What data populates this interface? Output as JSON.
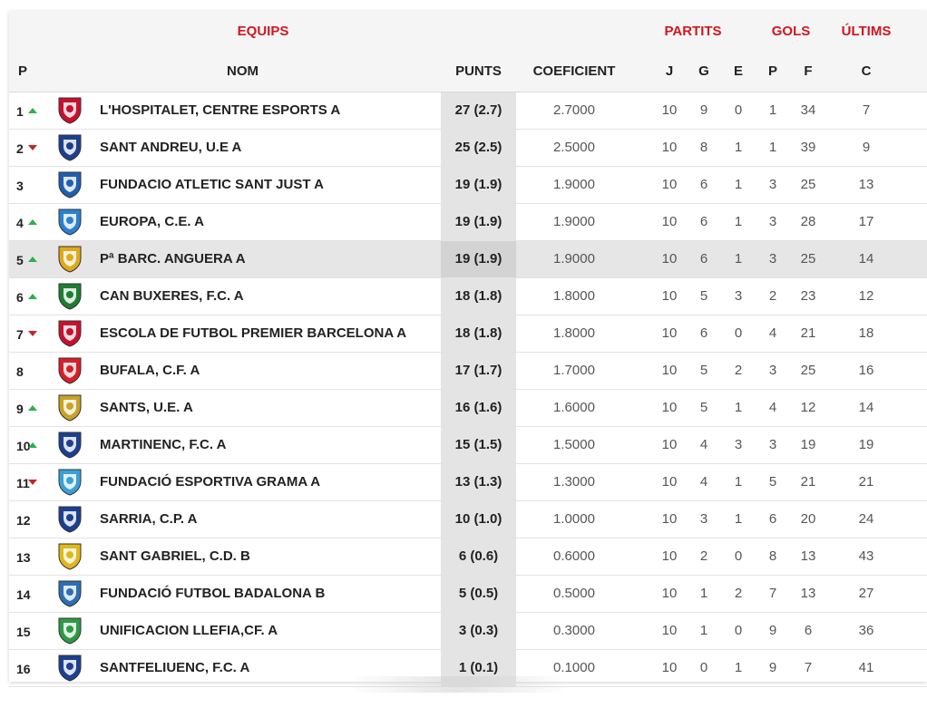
{
  "header": {
    "group_equips": "EQUIPS",
    "group_partits": "PARTITS",
    "group_gols": "GOLS",
    "group_ultims": "ÚLTIMS",
    "col_p": "P",
    "col_nom": "NOM",
    "col_punts": "PUNTS",
    "col_coef": "COEFICIENT",
    "col_j": "J",
    "col_g": "G",
    "col_e": "E",
    "col_pp": "P",
    "col_f": "F",
    "col_c": "C"
  },
  "colors": {
    "accent": "#d0161f",
    "up": "#2eb04b",
    "down": "#c0272d",
    "highlight_row": "#e6e6e6"
  },
  "rows": [
    {
      "pos": "1",
      "trend": "up",
      "crest": "hospitalet-crest-icon",
      "crest_color": "#c8102e",
      "name": "L'HOSPITALET, CENTRE ESPORTS A",
      "punts": "27 (2.7)",
      "coef": "2.7000",
      "j": "10",
      "g": "9",
      "e": "0",
      "p": "1",
      "f": "34",
      "c": "7"
    },
    {
      "pos": "2",
      "trend": "down",
      "crest": "sant-andreu-crest-icon",
      "crest_color": "#1d3f8f",
      "name": "SANT ANDREU, U.E A",
      "punts": "25 (2.5)",
      "coef": "2.5000",
      "j": "10",
      "g": "8",
      "e": "1",
      "p": "1",
      "f": "39",
      "c": "9"
    },
    {
      "pos": "3",
      "trend": "none",
      "crest": "fundacio-atletic-crest-icon",
      "crest_color": "#1f5fb0",
      "name": "FUNDACIO ATLETIC SANT JUST A",
      "punts": "19 (1.9)",
      "coef": "1.9000",
      "j": "10",
      "g": "6",
      "e": "1",
      "p": "3",
      "f": "25",
      "c": "13"
    },
    {
      "pos": "4",
      "trend": "up",
      "crest": "europa-crest-icon",
      "crest_color": "#2c7fd1",
      "name": "EUROPA, C.E. A",
      "punts": "19 (1.9)",
      "coef": "1.9000",
      "j": "10",
      "g": "6",
      "e": "1",
      "p": "3",
      "f": "28",
      "c": "17"
    },
    {
      "pos": "5",
      "trend": "up",
      "crest": "anguera-crest-icon",
      "crest_color": "#e0a81c",
      "name": "Pª BARC. ANGUERA A",
      "punts": "19 (1.9)",
      "coef": "1.9000",
      "j": "10",
      "g": "6",
      "e": "1",
      "p": "3",
      "f": "25",
      "c": "14"
    },
    {
      "pos": "6",
      "trend": "up",
      "crest": "can-buxeres-crest-icon",
      "crest_color": "#1e7d32",
      "name": "CAN BUXERES, F.C. A",
      "punts": "18 (1.8)",
      "coef": "1.8000",
      "j": "10",
      "g": "5",
      "e": "3",
      "p": "2",
      "f": "23",
      "c": "12"
    },
    {
      "pos": "7",
      "trend": "down",
      "crest": "premier-barcelona-crest-icon",
      "crest_color": "#c8102e",
      "name": "ESCOLA DE FUTBOL PREMIER BARCELONA A",
      "punts": "18 (1.8)",
      "coef": "1.8000",
      "j": "10",
      "g": "6",
      "e": "0",
      "p": "4",
      "f": "21",
      "c": "18"
    },
    {
      "pos": "8",
      "trend": "none",
      "crest": "bufala-crest-icon",
      "crest_color": "#d81f26",
      "name": "BUFALA, C.F. A",
      "punts": "17 (1.7)",
      "coef": "1.7000",
      "j": "10",
      "g": "5",
      "e": "2",
      "p": "3",
      "f": "25",
      "c": "16"
    },
    {
      "pos": "9",
      "trend": "up",
      "crest": "sants-crest-icon",
      "crest_color": "#c9a227",
      "name": "SANTS, U.E. A",
      "punts": "16 (1.6)",
      "coef": "1.6000",
      "j": "10",
      "g": "5",
      "e": "1",
      "p": "4",
      "f": "12",
      "c": "14"
    },
    {
      "pos": "10",
      "trend": "up",
      "crest": "martinenc-crest-icon",
      "crest_color": "#1d3f8f",
      "name": "MARTINENC, F.C. A",
      "punts": "15 (1.5)",
      "coef": "1.5000",
      "j": "10",
      "g": "4",
      "e": "3",
      "p": "3",
      "f": "19",
      "c": "19"
    },
    {
      "pos": "11",
      "trend": "down",
      "crest": "grama-crest-icon",
      "crest_color": "#3aa0d8",
      "name": "FUNDACIÓ ESPORTIVA GRAMA A",
      "punts": "13 (1.3)",
      "coef": "1.3000",
      "j": "10",
      "g": "4",
      "e": "1",
      "p": "5",
      "f": "21",
      "c": "21"
    },
    {
      "pos": "12",
      "trend": "none",
      "crest": "sarria-crest-icon",
      "crest_color": "#1d3f8f",
      "name": "SARRIA, C.P. A",
      "punts": "10 (1.0)",
      "coef": "1.0000",
      "j": "10",
      "g": "3",
      "e": "1",
      "p": "6",
      "f": "20",
      "c": "24"
    },
    {
      "pos": "13",
      "trend": "none",
      "crest": "sant-gabriel-crest-icon",
      "crest_color": "#e0b81c",
      "name": "SANT GABRIEL, C.D. B",
      "punts": "6 (0.6)",
      "coef": "0.6000",
      "j": "10",
      "g": "2",
      "e": "0",
      "p": "8",
      "f": "13",
      "c": "43"
    },
    {
      "pos": "14",
      "trend": "none",
      "crest": "badalona-crest-icon",
      "crest_color": "#2c6fb5",
      "name": "FUNDACIÓ FUTBOL BADALONA B",
      "punts": "5 (0.5)",
      "coef": "0.5000",
      "j": "10",
      "g": "1",
      "e": "2",
      "p": "7",
      "f": "13",
      "c": "27"
    },
    {
      "pos": "15",
      "trend": "none",
      "crest": "llefia-crest-icon",
      "crest_color": "#2e9a46",
      "name": "UNIFICACION LLEFIA,CF. A",
      "punts": "3 (0.3)",
      "coef": "0.3000",
      "j": "10",
      "g": "1",
      "e": "0",
      "p": "9",
      "f": "6",
      "c": "36"
    },
    {
      "pos": "16",
      "trend": "none",
      "crest": "santfeliuenc-crest-icon",
      "crest_color": "#1d3f8f",
      "name": "SANTFELIUENC, F.C. A",
      "punts": "1 (0.1)",
      "coef": "0.1000",
      "j": "10",
      "g": "0",
      "e": "1",
      "p": "9",
      "f": "7",
      "c": "41"
    }
  ]
}
